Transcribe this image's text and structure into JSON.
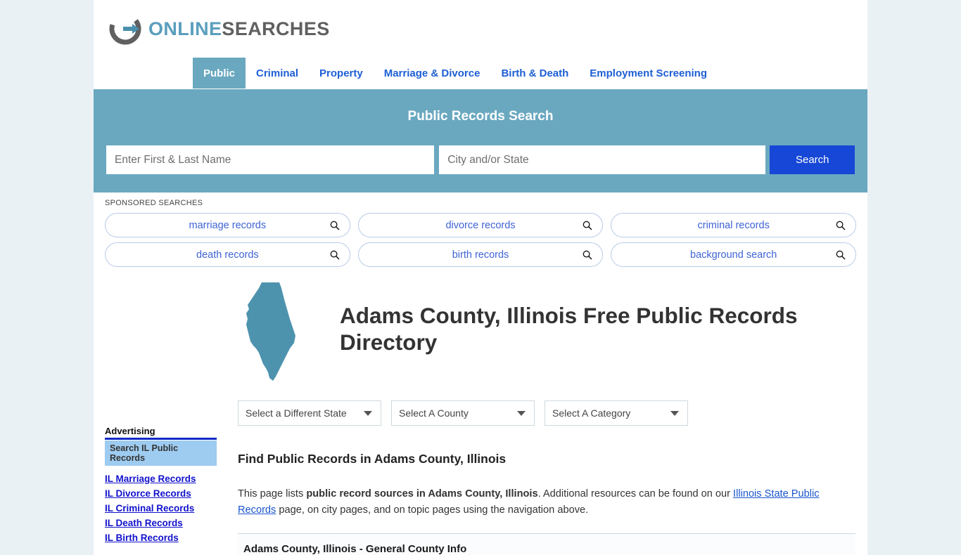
{
  "brand": {
    "logo_icon": "circular-arrow-icon",
    "name_part1": "ONLINE",
    "name_part2": "SEARCHES"
  },
  "nav": {
    "items": [
      {
        "label": "Public",
        "active": true
      },
      {
        "label": "Criminal",
        "active": false
      },
      {
        "label": "Property",
        "active": false
      },
      {
        "label": "Marriage & Divorce",
        "active": false
      },
      {
        "label": "Birth & Death",
        "active": false
      },
      {
        "label": "Employment Screening",
        "active": false
      }
    ]
  },
  "search": {
    "title": "Public Records Search",
    "name_placeholder": "Enter First & Last Name",
    "name_value": "",
    "location_placeholder": "City and/or State",
    "location_value": "",
    "button_label": "Search"
  },
  "sponsored": {
    "label": "SPONSORED SEARCHES",
    "items": [
      "marriage records",
      "divorce records",
      "criminal records",
      "death records",
      "birth records",
      "background search"
    ]
  },
  "sidebar": {
    "advertising_label": "Advertising",
    "panel_title": "Search IL Public Records",
    "links": [
      "IL Marriage Records",
      "IL Divorce Records",
      "IL Criminal Records",
      "IL Death Records",
      "IL Birth Records"
    ]
  },
  "main": {
    "state_map_icon": "illinois-state-map-icon",
    "page_title": "Adams County, Illinois Free Public Records Directory",
    "selects": {
      "state": "Select a Different State",
      "county": "Select A County",
      "category": "Select A Category"
    },
    "section_heading": "Find Public Records in Adams County, Illinois",
    "paragraph": {
      "lead": "This page lists ",
      "bold": "public record sources in Adams County, Illinois",
      "mid": ". Additional resources can be found on our ",
      "link": "Illinois State Public Records",
      "tail": " page, on city pages, and on topic pages using the navigation above."
    },
    "table_section_title": "Adams County, Illinois - General County Info"
  },
  "colors": {
    "banner_teal": "#6aa8c0",
    "search_button_blue": "#1647d6",
    "link_blue": "#1a55cc",
    "nav_blue": "#1d5fd4",
    "page_bg": "#eaf1f5",
    "sidebar_panel_blue": "#9ecbf0",
    "sidebar_bar_blue": "#1029c8"
  }
}
